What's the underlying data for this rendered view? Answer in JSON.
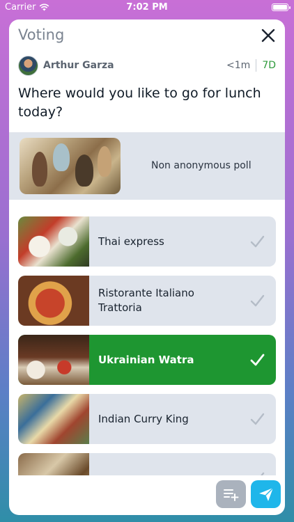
{
  "status_bar": {
    "carrier": "Carrier",
    "time": "7:02 PM"
  },
  "header": {
    "title": "Voting"
  },
  "author": {
    "name": "Arthur Garza",
    "posted": "<1m",
    "duration": "7D"
  },
  "question": "Where would you like to go for lunch today?",
  "poll": {
    "type_label": "Non anonymous poll"
  },
  "options": [
    {
      "label": "Thai express",
      "selected": false
    },
    {
      "label": "Ristorante Italiano Trattoria",
      "selected": false
    },
    {
      "label": "Ukrainian Watra",
      "selected": true
    },
    {
      "label": "Indian Curry King",
      "selected": false
    },
    {
      "label": "",
      "selected": false
    }
  ],
  "icons": {
    "close": "close-icon",
    "check": "checkmark-icon",
    "add_option": "add-to-list-icon",
    "send": "send-icon",
    "wifi": "wifi-icon",
    "battery": "battery-icon"
  },
  "colors": {
    "accent_green": "#1e9631",
    "duration_green": "#2e9a3b",
    "send_blue": "#1fb6ea",
    "option_bg": "#dfe4ec"
  }
}
